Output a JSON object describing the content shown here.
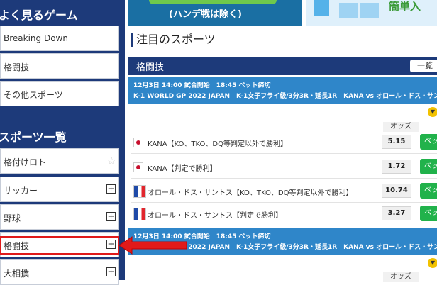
{
  "sidebar": {
    "popular_title": "よく見るゲーム",
    "popular_items": [
      {
        "label": "Breaking Down"
      },
      {
        "label": "格闘技"
      },
      {
        "label": "その他スポーツ"
      }
    ],
    "sports_title": "スポーツ一覧",
    "sports_items": [
      {
        "label": "格付けロト",
        "icon": "star-icon"
      },
      {
        "label": "サッカー",
        "icon": "plus-icon"
      },
      {
        "label": "野球",
        "icon": "plus-icon"
      },
      {
        "label": "格闘技",
        "icon": "plus-icon"
      },
      {
        "label": "大相撲",
        "icon": "plus-icon"
      }
    ]
  },
  "banners": {
    "left_text": "(ハンデ戦は除く)",
    "right_text": "簡単入"
  },
  "main": {
    "section_title": "注目のスポーツ",
    "category_label": "格闘技",
    "list_button": "一覧",
    "odds_header": "オッズ",
    "matches": [
      {
        "time_line": "12月3日 14:00 試合開始　18:45 ベット締切",
        "event_line": "K-1 WORLD GP 2022 JAPAN　K-1女子フライ級/3分3R・延長1R　KANA vs オロール・ドス・サントス",
        "outcomes": [
          {
            "flag": "jp",
            "name": "KANA【KO、TKO、DQ等判定以外で勝利】",
            "odds": "5.15",
            "bet": "ベッ"
          },
          {
            "flag": "jp",
            "name": "KANA【判定で勝利】",
            "odds": "1.72",
            "bet": "ベッ"
          },
          {
            "flag": "fr",
            "name": "オロール・ドス・サントス【KO、TKO、DQ等判定以外で勝利】",
            "odds": "10.74",
            "bet": "ベッ"
          },
          {
            "flag": "fr",
            "name": "オロール・ドス・サントス【判定で勝利】",
            "odds": "3.27",
            "bet": "ベッ"
          }
        ]
      },
      {
        "time_line": "12月3日 14:00 試合開始　18:45 ベット締切",
        "event_line": "K-1 WORLD GP 2022 JAPAN　K-1女子フライ級/3分3R・延長1R　KANA vs オロール・ドス・サントス"
      }
    ]
  },
  "colors": {
    "sidebar_bg": "#1d3a7a",
    "highlight": "#e11a1a",
    "bet_green": "#21b24b",
    "match_header": "#2f86c9"
  }
}
